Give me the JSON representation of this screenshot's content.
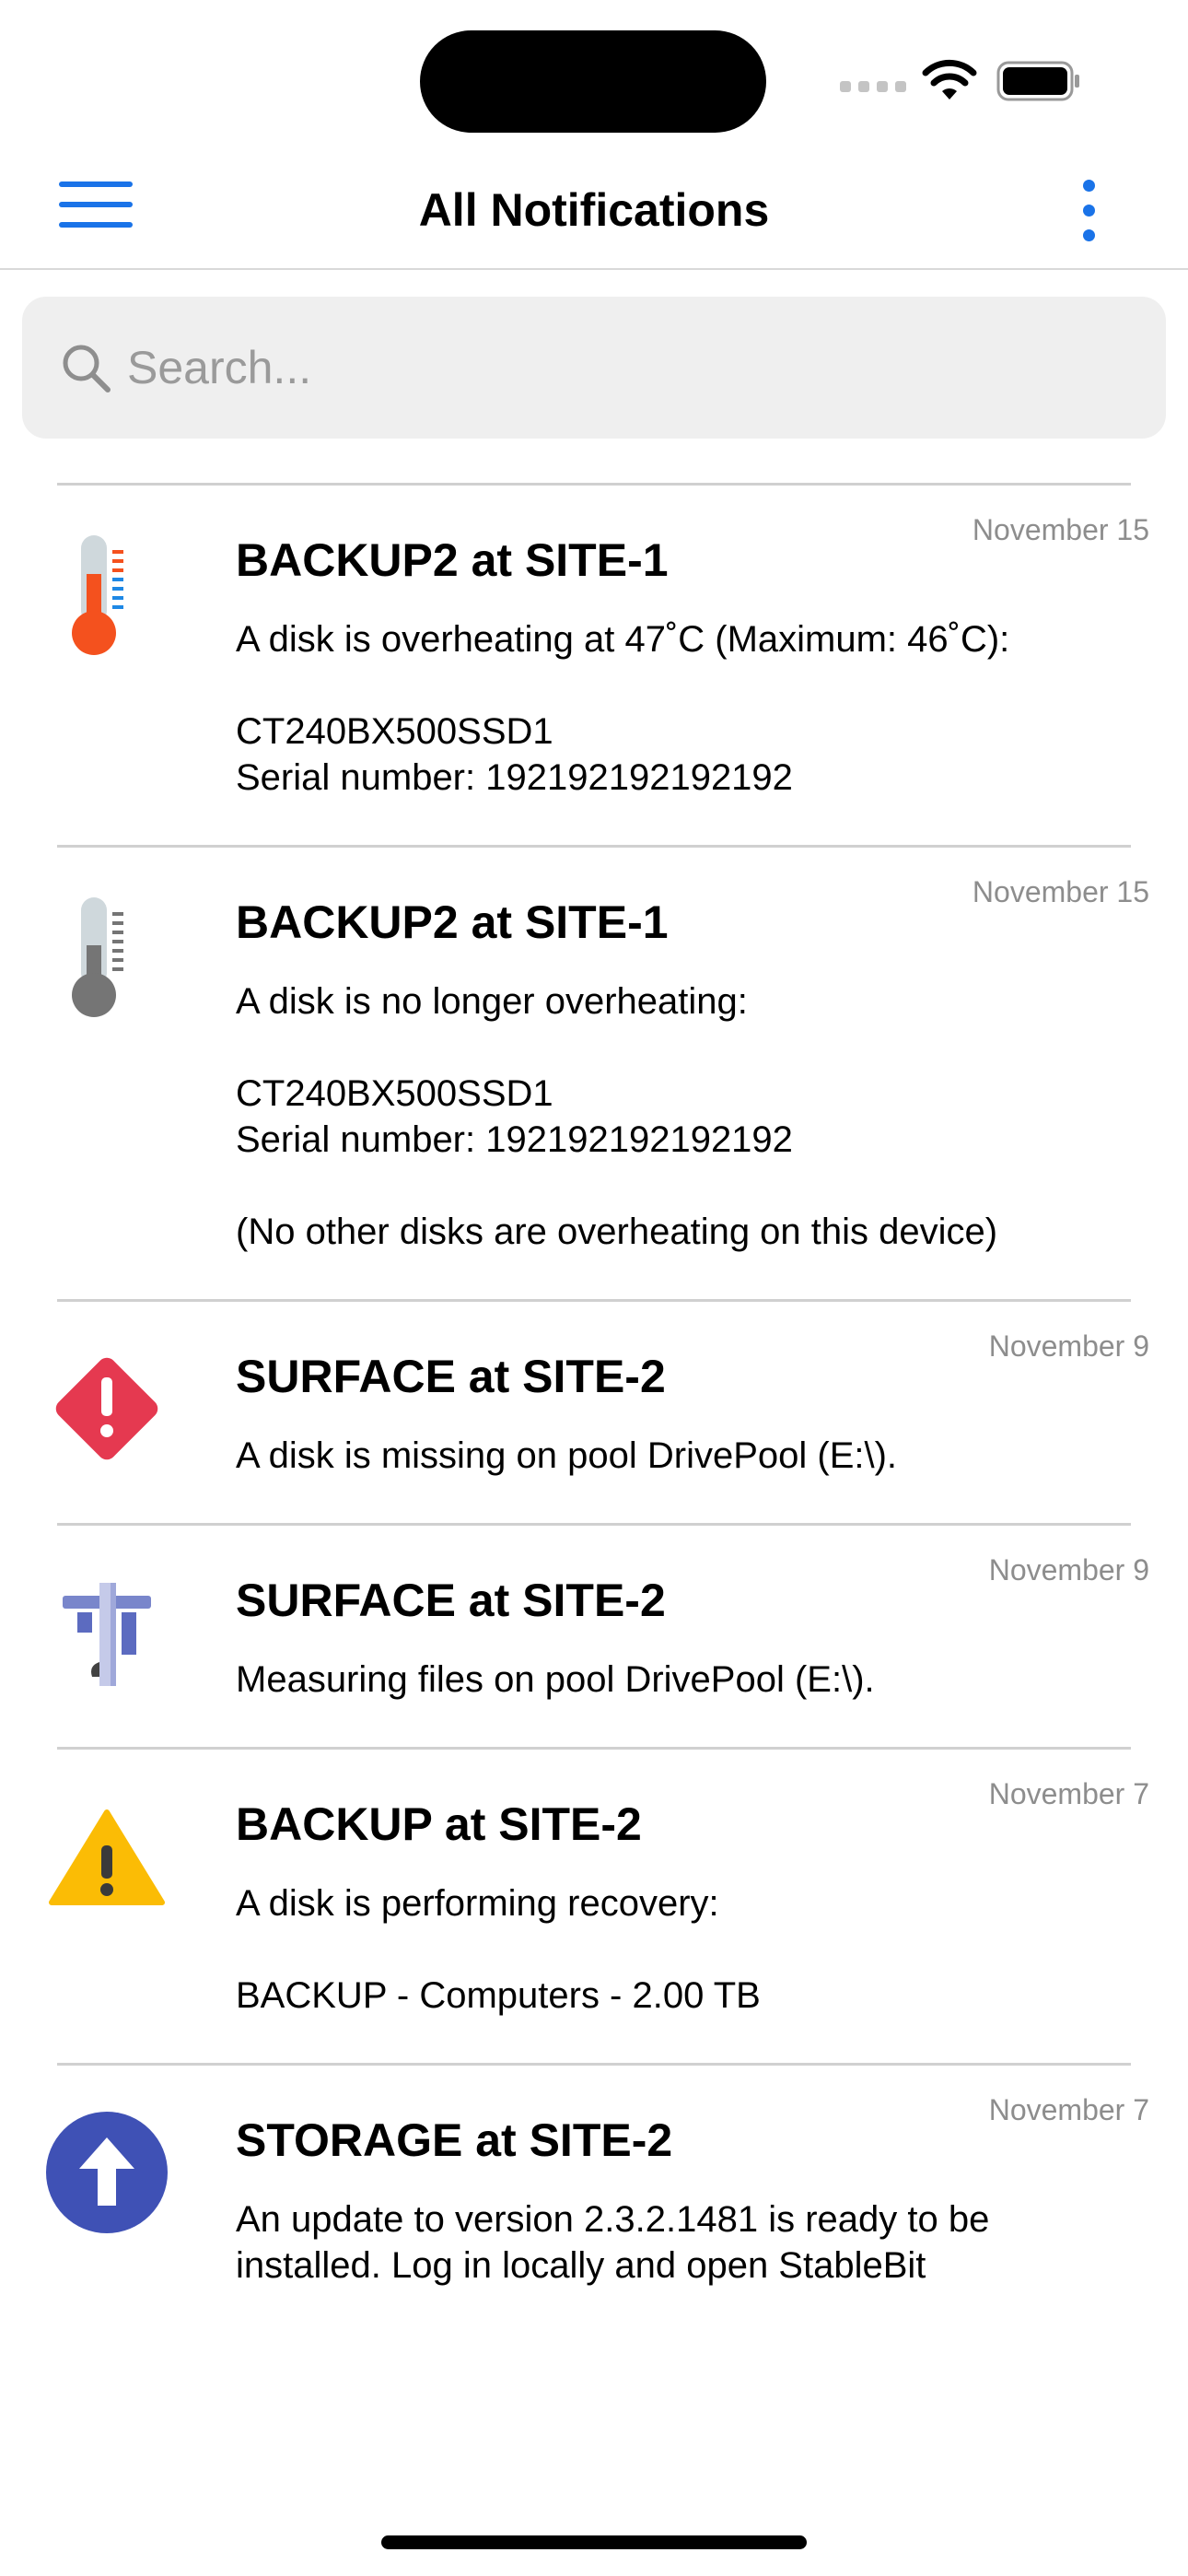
{
  "status_bar": {
    "wifi_icon": "wifi-icon",
    "battery_icon": "battery-icon"
  },
  "header": {
    "title": "All Notifications",
    "menu_icon": "hamburger-menu-icon",
    "more_icon": "more-vertical-icon"
  },
  "search": {
    "placeholder": "Search...",
    "value": ""
  },
  "notifications": [
    {
      "icon": "thermometer-hot-icon",
      "title": "BACKUP2 at SITE-1",
      "date": "November 15",
      "message": "A disk is overheating at 47˚C (Maximum: 46˚C):\n\nCT240BX500SSD1\n  Serial number: 192192192192192"
    },
    {
      "icon": "thermometer-normal-icon",
      "title": "BACKUP2 at SITE-1",
      "date": "November 15",
      "message": "A disk is no longer overheating:\n\nCT240BX500SSD1\n  Serial number: 192192192192192\n\n(No other disks are overheating on this device)"
    },
    {
      "icon": "error-diamond-icon",
      "title": "SURFACE at SITE-2",
      "date": "November 9",
      "message": "A disk is missing on pool DrivePool (E:\\)."
    },
    {
      "icon": "caliper-icon",
      "title": "SURFACE at SITE-2",
      "date": "November 9",
      "message": "Measuring files on pool DrivePool (E:\\)."
    },
    {
      "icon": "warning-triangle-icon",
      "title": "BACKUP at SITE-2",
      "date": "November 7",
      "message": "A disk is performing recovery:\n\nBACKUP - Computers - 2.00 TB"
    },
    {
      "icon": "update-arrow-icon",
      "title": "STORAGE at SITE-2",
      "date": "November 7",
      "message": "An update to version 2.3.2.1481 is ready to be installed. Log in locally and open StableBit"
    }
  ],
  "colors": {
    "accent": "#1a73e8",
    "hot_red": "#f4511e",
    "error_red": "#e53950",
    "warning_yellow": "#fbbc05",
    "update_blue": "#3f51b5"
  }
}
